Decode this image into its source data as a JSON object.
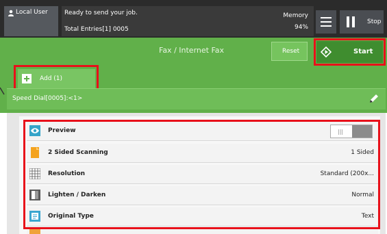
{
  "header": {
    "user_label": "Local User",
    "status_line1": "Ready to send your job.",
    "status_line2": "Total Entries[1] 0005",
    "memory_label": "Memory",
    "memory_value": "94%",
    "stop_label": "Stop"
  },
  "app": {
    "title": "Fax / Internet Fax",
    "reset_label": "Reset",
    "start_label": "Start",
    "add_label": "Add (1)",
    "speed_dial": "Speed Dial[0005]:<1>"
  },
  "settings": [
    {
      "label": "Preview",
      "value": "",
      "icon": "eye-icon"
    },
    {
      "label": "2 Sided Scanning",
      "value": "1 Sided",
      "icon": "document-icon"
    },
    {
      "label": "Resolution",
      "value": "Standard (200x...",
      "icon": "grid-icon"
    },
    {
      "label": "Lighten / Darken",
      "value": "Normal",
      "icon": "contrast-icon"
    },
    {
      "label": "Original Type",
      "value": "Text",
      "icon": "original-type-icon"
    }
  ],
  "colors": {
    "accent_green": "#61b04a",
    "start_green": "#3f8d2f",
    "highlight_red": "#e8101a",
    "topbar": "#2b2b2b"
  }
}
